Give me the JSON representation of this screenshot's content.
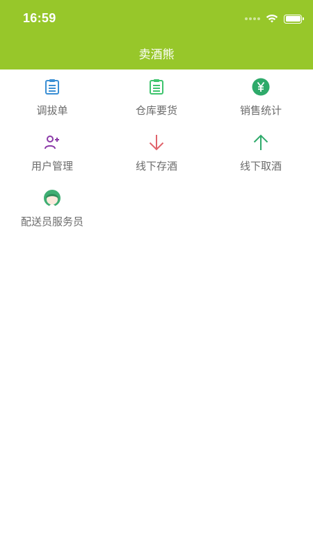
{
  "status_bar": {
    "time": "16:59"
  },
  "header": {
    "title": "卖酒熊"
  },
  "menu": [
    {
      "id": "transfer-order",
      "label": "调拔单",
      "icon": "clipboard-list-icon",
      "color": "#3a8fd4"
    },
    {
      "id": "warehouse-request",
      "label": "仓库要货",
      "icon": "clipboard-list-icon",
      "color": "#3ec46d"
    },
    {
      "id": "sales-stats",
      "label": "销售统计",
      "icon": "yen-circle-icon",
      "color": "#2eaa6a"
    },
    {
      "id": "user-management",
      "label": "用户管理",
      "icon": "add-user-icon",
      "color": "#8b3aa8"
    },
    {
      "id": "offline-deposit-wine",
      "label": "线下存酒",
      "icon": "arrow-down-icon",
      "color": "#e0636b"
    },
    {
      "id": "offline-withdraw-wine",
      "label": "线下取酒",
      "icon": "arrow-up-icon",
      "color": "#2eaa6a"
    },
    {
      "id": "delivery-staff",
      "label": "配送员服务员",
      "icon": "staff-avatar-icon",
      "color": "#3fae73"
    }
  ]
}
